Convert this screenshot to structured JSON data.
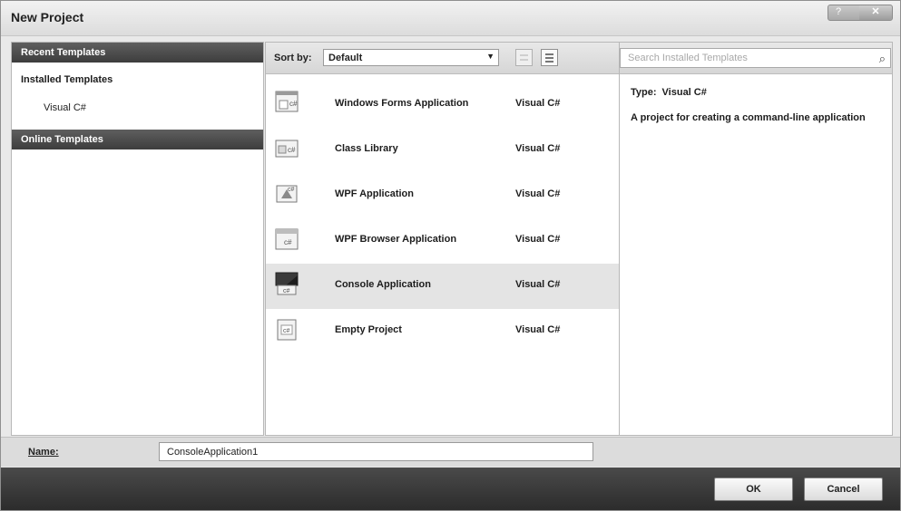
{
  "window": {
    "title": "New Project"
  },
  "left_pane": {
    "recent_templates": "Recent Templates",
    "installed_templates": "Installed Templates",
    "installed_sub": "Visual C#",
    "online_templates": "Online Templates"
  },
  "toolbar": {
    "sort_label": "Sort by:",
    "sort_value": "Default"
  },
  "templates": [
    {
      "name": "Windows Forms Application",
      "lang": "Visual C#",
      "icon": "winforms-icon"
    },
    {
      "name": "Class Library",
      "lang": "Visual C#",
      "icon": "class-library-icon"
    },
    {
      "name": "WPF Application",
      "lang": "Visual C#",
      "icon": "wpf-icon"
    },
    {
      "name": "WPF Browser Application",
      "lang": "Visual C#",
      "icon": "wpf-browser-icon"
    },
    {
      "name": "Console Application",
      "lang": "Visual C#",
      "icon": "console-icon"
    },
    {
      "name": "Empty Project",
      "lang": "Visual C#",
      "icon": "empty-project-icon"
    }
  ],
  "selected_template": "Console Application",
  "search": {
    "placeholder": "Search Installed Templates"
  },
  "details": {
    "type_label": "Type:",
    "type_value": "Visual C#",
    "description": "A project for creating a command-line application"
  },
  "name_row": {
    "label": "Name:",
    "value": "ConsoleApplication1"
  },
  "buttons": {
    "ok": "OK",
    "cancel": "Cancel"
  }
}
